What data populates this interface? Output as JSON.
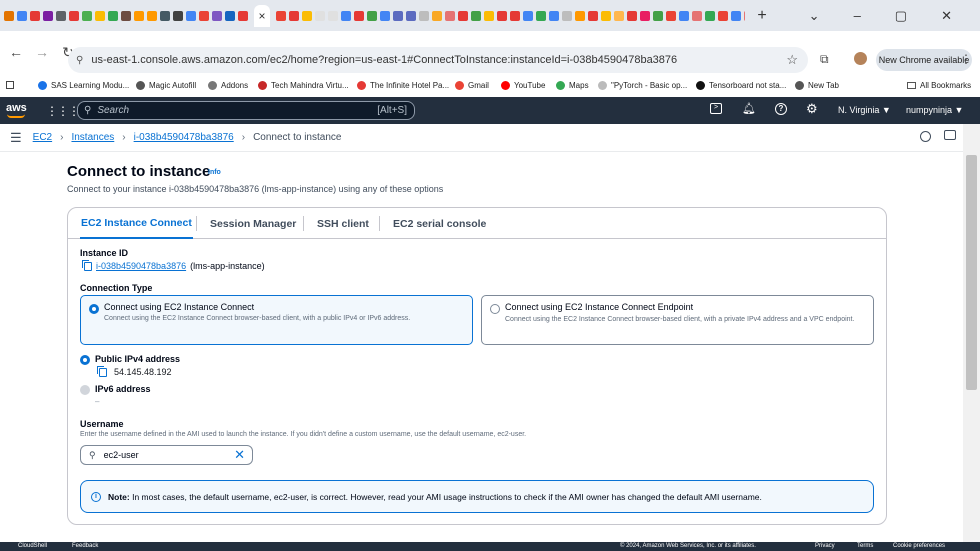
{
  "browser": {
    "favicon_colors": [
      "#e37400",
      "#4285f4",
      "#e53935",
      "#7b1fa2",
      "#5f6368",
      "#e53935",
      "#4caf50",
      "#fbbc04",
      "#34a853",
      "#6d4c41",
      "#ff9900",
      "#ff9900",
      "#455a64",
      "#424242",
      "#4285f4",
      "#ea4335",
      "#7e57c2",
      "#1565c0",
      "#e53935",
      "#ea4335",
      "#e53935",
      "#fbbc04",
      "#e0e0e0",
      "#e0e0e0",
      "#4285f4",
      "#e53935",
      "#43a047",
      "#4285f4",
      "#5c6bc0",
      "#5c6bc0",
      "#bdbdbd",
      "#f9a825",
      "#e57373",
      "#e53935",
      "#43a047",
      "#fbbc04",
      "#e53935",
      "#e53935",
      "#4285f4",
      "#34a853",
      "#4285f4",
      "#bdbdbd",
      "#ff9800",
      "#e53935",
      "#fbbc04",
      "#ffb74d",
      "#e53935",
      "#e91e63",
      "#43a047",
      "#ea4335",
      "#4285f4",
      "#e57373",
      "#34a853",
      "#ea4335",
      "#4285f4",
      "#e57373",
      "#ea4335",
      "#7b1fa2",
      "#4285f4",
      "#212121",
      "#c0ca33",
      "#4285f4",
      "#ea4335",
      "#4285f4"
    ],
    "active_tab_close": "×",
    "new_tab": "+",
    "window_controls": [
      "⌄",
      "–",
      "▢",
      "✕"
    ],
    "url": "us-east-1.console.aws.amazon.com/ec2/home?region=us-east-1#ConnectToInstance:instanceId=i-038b4590478ba3876",
    "new_chrome_label": "New Chrome available",
    "bookmarks": [
      {
        "label": "SAS Learning Modu..."
      },
      {
        "label": "Magic Autofill"
      },
      {
        "label": "Addons"
      },
      {
        "label": "Tech Mahindra Virtu..."
      },
      {
        "label": "The Infinite Hotel Pa..."
      },
      {
        "label": "Gmail"
      },
      {
        "label": "YouTube"
      },
      {
        "label": "Maps"
      },
      {
        "label": "\"PyTorch - Basic op..."
      },
      {
        "label": "Tensorboard not sta..."
      },
      {
        "label": "New Tab"
      }
    ],
    "all_bookmarks": "All Bookmarks"
  },
  "aws_nav": {
    "logo": "aws",
    "search_placeholder": "Search",
    "search_shortcut": "[Alt+S]",
    "region": "N. Virginia ▼",
    "account": "numpyninja ▼"
  },
  "breadcrumb": [
    "EC2",
    "Instances",
    "i-038b4590478ba3876",
    "Connect to instance"
  ],
  "page": {
    "title": "Connect to instance",
    "info": "Info",
    "subtitle": "Connect to your instance i-038b4590478ba3876 (lms-app-instance) using any of these options"
  },
  "tabs": [
    "EC2 Instance Connect",
    "Session Manager",
    "SSH client",
    "EC2 serial console"
  ],
  "instance": {
    "id_label": "Instance ID",
    "id": "i-038b4590478ba3876",
    "name": "(lms-app-instance)"
  },
  "connection_type": {
    "label": "Connection Type",
    "options": [
      {
        "title": "Connect using EC2 Instance Connect",
        "desc": "Connect using the EC2 Instance Connect browser-based client, with a public IPv4 or IPv6 address.",
        "selected": true
      },
      {
        "title": "Connect using EC2 Instance Connect Endpoint",
        "desc": "Connect using the EC2 Instance Connect browser-based client, with a private IPv4 address and a VPC endpoint.",
        "selected": false
      }
    ]
  },
  "address": {
    "ipv4_label": "Public IPv4 address",
    "ipv4": "54.145.48.192",
    "ipv6_label": "IPv6 address",
    "ipv6": "–"
  },
  "username": {
    "label": "Username",
    "help": "Enter the username defined in the AMI used to launch the instance. If you didn't define a custom username, use the default username, ec2-user.",
    "value": "ec2-user"
  },
  "note": {
    "bold": "Note:",
    "text": " In most cases, the default username, ec2-user, is correct. However, read your AMI usage instructions to check if the AMI owner has changed the default AMI username."
  },
  "footer": {
    "left": [
      "CloudShell",
      "Feedback"
    ],
    "right": [
      "© 2024, Amazon Web Services, Inc. or its affiliates.",
      "Privacy",
      "Terms",
      "Cookie preferences"
    ]
  }
}
